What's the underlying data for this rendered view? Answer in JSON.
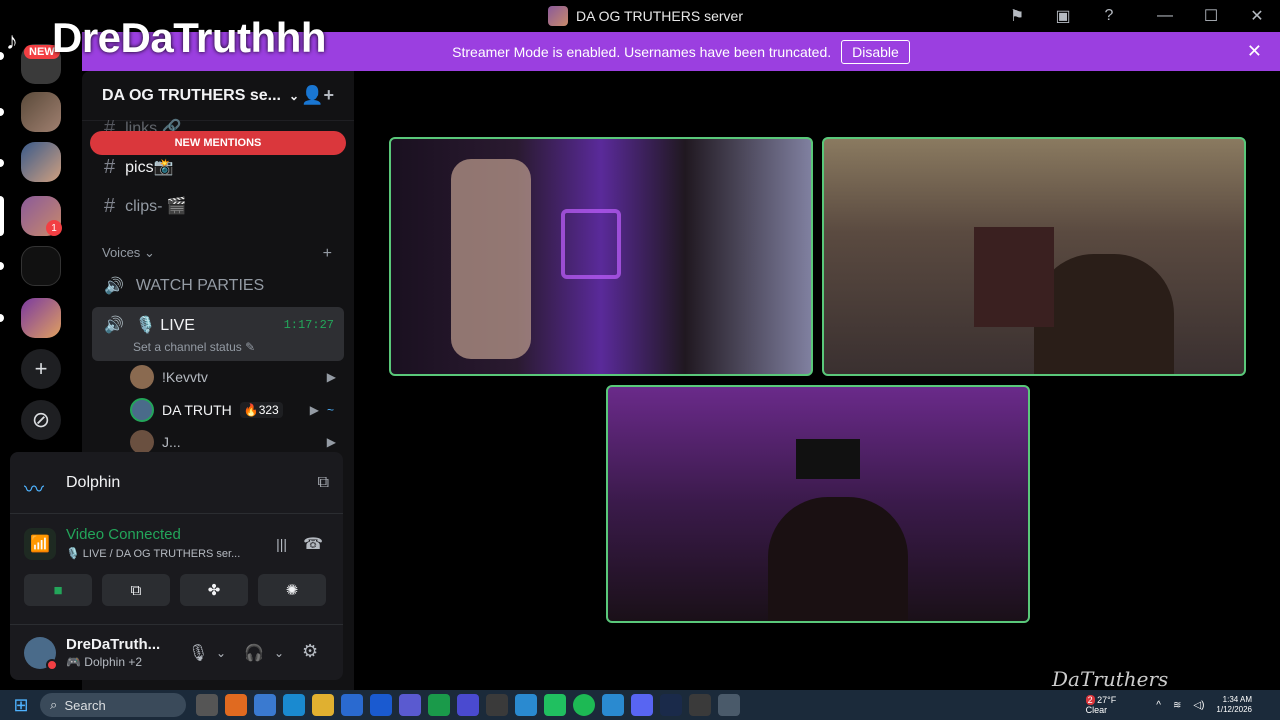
{
  "window": {
    "title": "DA OG TRUTHERS server"
  },
  "overlay": {
    "streamer_name": "DreDaTruthhh",
    "new_badge": "NEW"
  },
  "banner": {
    "text": "Streamer Mode is enabled. Usernames have been truncated.",
    "disable_label": "Disable"
  },
  "rail": {
    "mention_count": "1"
  },
  "sidebar": {
    "server_name": "DA OG TRUTHERS se...",
    "new_mentions": "NEW MENTIONS",
    "channels": [
      {
        "name": "links 🔗"
      },
      {
        "name": "pics📸"
      },
      {
        "name": "clips- 🎬"
      }
    ],
    "voice_category": "Voices",
    "voice_channels": [
      {
        "name": "WATCH PARTIES"
      },
      {
        "name": "🎙️ LIVE",
        "timer": "1:17:27",
        "status": "Set a channel status"
      }
    ],
    "members": [
      {
        "name": "!Kevvtv"
      },
      {
        "name": "DA TRUTH",
        "badge": "323"
      },
      {
        "name": "J..."
      }
    ]
  },
  "panel": {
    "activity_name": "Dolphin",
    "connection_status": "Video Connected",
    "connection_sub": "🎙️ LIVE / DA OG TRUTHERS ser...",
    "user_name": "DreDaTruth...",
    "user_status": "Dolphin +2"
  },
  "taskbar": {
    "search": "Search",
    "weather_temp": "27°F",
    "weather_desc": "Clear",
    "weather_badge": "2",
    "time": "1:34 AM",
    "date": "1/12/2026"
  },
  "watermark": "DaTruthers",
  "colors": {
    "accent_purple": "#9b3fe0",
    "green": "#23a55a",
    "red": "#da373c"
  }
}
